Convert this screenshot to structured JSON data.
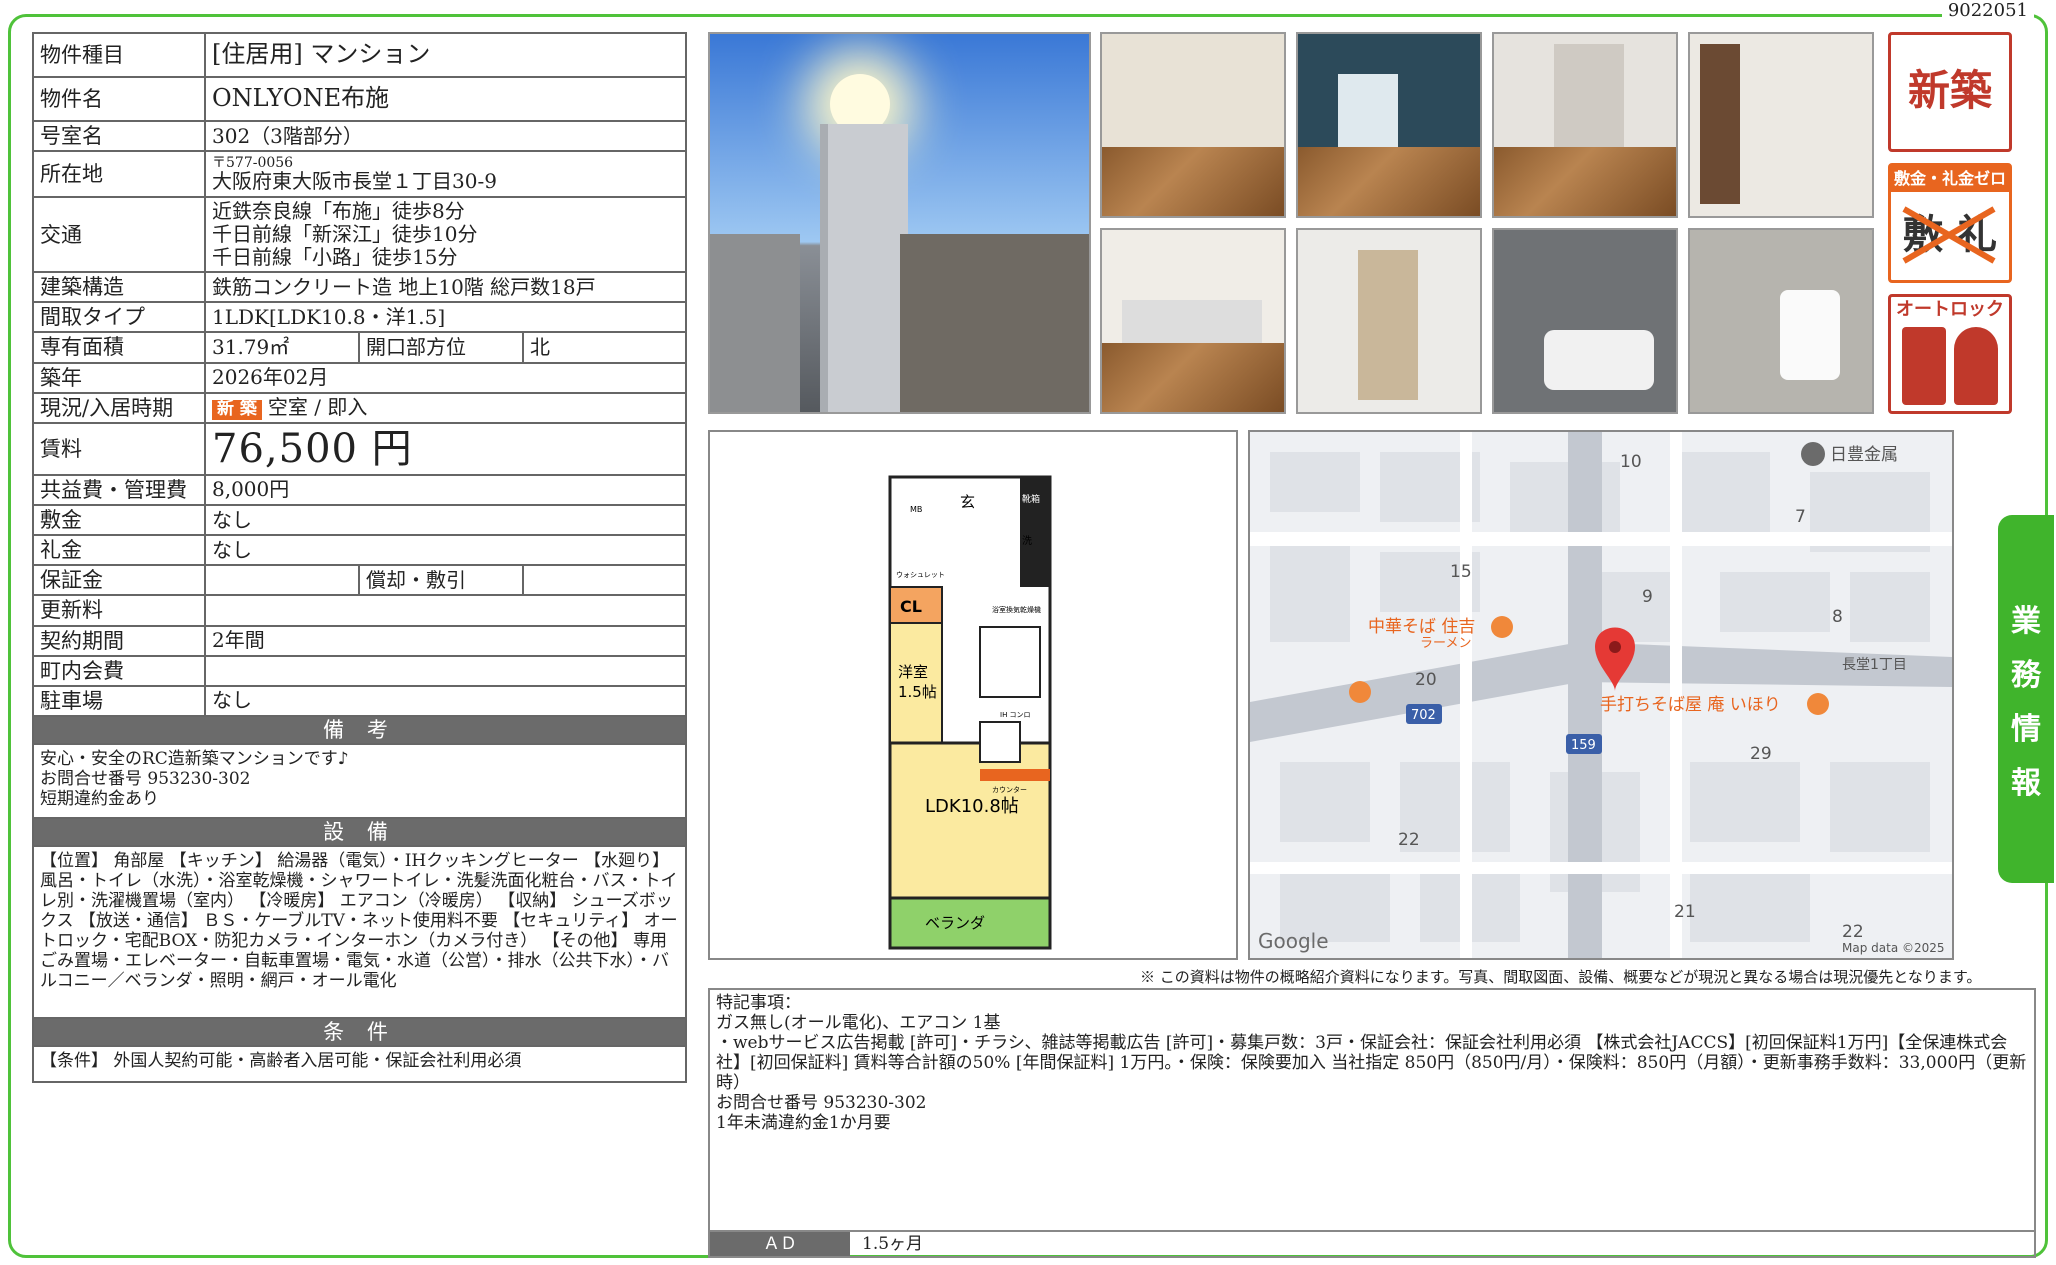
{
  "doc_id": "9022051",
  "property": {
    "rows": [
      {
        "label": "物件種目",
        "value": "[住居用] マンション"
      },
      {
        "label": "物件名",
        "value": "ONLYONE布施"
      },
      {
        "label": "号室名",
        "value": "302（3階部分）"
      },
      {
        "label": "所在地",
        "postal": "〒577-0056",
        "value": "大阪府東大阪市長堂１丁目30-9"
      },
      {
        "label": "交通",
        "lines": [
          "近鉄奈良線「布施」徒歩8分",
          "千日前線「新深江」徒歩10分",
          "千日前線「小路」徒歩15分"
        ]
      },
      {
        "label": "建築構造",
        "value": "鉄筋コンクリート造 地上10階 総戸数18戸"
      },
      {
        "label": "間取タイプ",
        "value": "1LDK[LDK10.8・洋1.5]"
      },
      {
        "label": "専有面積",
        "value": "31.79㎡",
        "sub_label": "開口部方位",
        "sub_value": "北"
      },
      {
        "label": "築年",
        "value": "2026年02月"
      },
      {
        "label": "現況/入居時期",
        "tag": "新 築",
        "value": "空室 / 即入"
      },
      {
        "label": "賃料",
        "value": "76,500 円"
      },
      {
        "label": "共益費・管理費",
        "value": "8,000円"
      },
      {
        "label": "敷金",
        "value": "なし"
      },
      {
        "label": "礼金",
        "value": "なし"
      },
      {
        "label": "保証金",
        "value": "",
        "sub_label": "償却・敷引",
        "sub_value": ""
      },
      {
        "label": "更新料",
        "value": ""
      },
      {
        "label": "契約期間",
        "value": "2年間"
      },
      {
        "label": "町内会費",
        "value": ""
      },
      {
        "label": "駐車場",
        "value": "なし"
      }
    ]
  },
  "remarks": {
    "title": "備 考",
    "lines": [
      "安心・安全のRC造新築マンションです♪",
      "お問合せ番号 953230-302",
      "短期違約金あり"
    ]
  },
  "equipment": {
    "title": "設 備",
    "text": "【位置】 角部屋 【キッチン】 給湯器（電気）・IHクッキングヒーター 【水廻り】 風呂・トイレ（水洗）・浴室乾燥機・シャワートイレ・洗髪洗面化粧台・バス・トイレ別・洗濯機置場（室内） 【冷暖房】 エアコン（冷暖房） 【収納】 シューズボックス 【放送・通信】 ＢＳ・ケーブルTV・ネット使用料不要 【セキュリティ】 オートロック・宅配BOX・防犯カメラ・インターホン（カメラ付き） 【その他】 専用ごみ置場・エレベーター・自転車置場・電気・水道（公営）・排水（公共下水）・バルコニー／ベランダ・照明・網戸・オール電化"
  },
  "conditions": {
    "title": "条 件",
    "text": "【条件】 外国人契約可能・高齢者入居可能・保証会社利用必須"
  },
  "badges": {
    "new": "新築",
    "zero": "敷金・礼金ゼロ",
    "zero_strike": "敷 礼",
    "autolock": "オートロック"
  },
  "floorplan": {
    "genkan": "玄",
    "cl": "CL",
    "yoshitsu": "洋室",
    "yoshitsu_size": "1.5帖",
    "ldk": "LDK10.8帖",
    "veranda": "ベランダ",
    "bath_dryer": "浴室換気乾燥機",
    "ih": "IH コンロ",
    "counter": "カウンター",
    "toilet": "ウォシュレット",
    "mb": "MB",
    "shoe": "靴箱",
    "wash": "洗"
  },
  "map": {
    "labels": [
      "日豊金属",
      "10",
      "7",
      "15",
      "9",
      "8",
      "長堂1丁目",
      "中華そば 住吉",
      "ラーメン",
      "20",
      "702",
      "159",
      "手打ちそば屋 庵 いほり",
      "29",
      "22",
      "21",
      "22"
    ],
    "google": "Google",
    "copyright": "Map data ©2025"
  },
  "notice": "※ この資料は物件の概略紹介資料になります。写真、間取図面、設備、概要などが現況と異なる場合は現況優先となります。",
  "special": {
    "title": "特記事項：",
    "lines": [
      "ガス無し(オール電化)、エアコン 1基",
      "・webサービス広告掲載 [許可]・チラシ、雑誌等掲載広告 [許可]・募集戸数：3戸・保証会社：保証会社利用必須 【株式会社JACCS】[初回保証料1万円]【全保連株式会社】[初回保証料] 賃料等合計額の50% [年間保証料] 1万円。・保険：保険要加入 当社指定 850円（850円/月）・保険料：850円（月額）・更新事務手数料：33,000円（更新時）",
      "お問合せ番号 953230-302",
      "1年未満違約金1か月要"
    ]
  },
  "ad": {
    "label": "ＡＤ",
    "value": "1.5ヶ月"
  },
  "side_tab": [
    "業",
    "務",
    "情",
    "報"
  ]
}
